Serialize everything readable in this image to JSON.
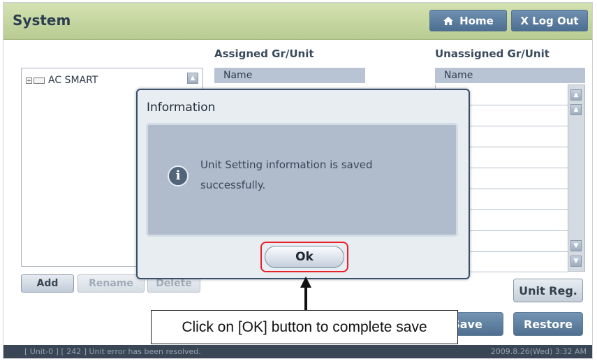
{
  "header": {
    "title": "System",
    "home_label": "Home",
    "logout_label": "X Log Out"
  },
  "panels": {
    "assigned_title": "Assigned Gr/Unit",
    "unassigned_title": "Unassigned Gr/Unit",
    "name_column": "Name"
  },
  "tree": {
    "root_label": "AC SMART",
    "expander_symbol": "+"
  },
  "buttons": {
    "add": "Add",
    "rename": "Rename",
    "delete": "Delete",
    "unit_reg": "Unit Reg.",
    "save": "Save",
    "restore": "Restore"
  },
  "status_bar": {
    "message": "[ Unit-0 ] [ 242 ] Unit error has been resolved.",
    "datetime": "2009.8.26(Wed) 3:32 AM"
  },
  "dialog": {
    "title": "Information",
    "message": "Unit Setting information is saved successfully.",
    "ok_label": "Ok",
    "icon_glyph": "i"
  },
  "annotation": {
    "callout_text": "Click on [OK] button to complete save"
  },
  "icons": {
    "home": "home-icon",
    "info": "info-icon",
    "scroll_up": "scroll-up-icon",
    "scroll_down": "scroll-down-icon",
    "scroll_top": "scroll-top-icon",
    "scroll_bottom": "scroll-bottom-icon"
  },
  "colors": {
    "header_green": "#c6d8a2",
    "button_blue": "#5b7ca0",
    "highlight_red": "#e8202a",
    "status_bar": "#394656"
  }
}
